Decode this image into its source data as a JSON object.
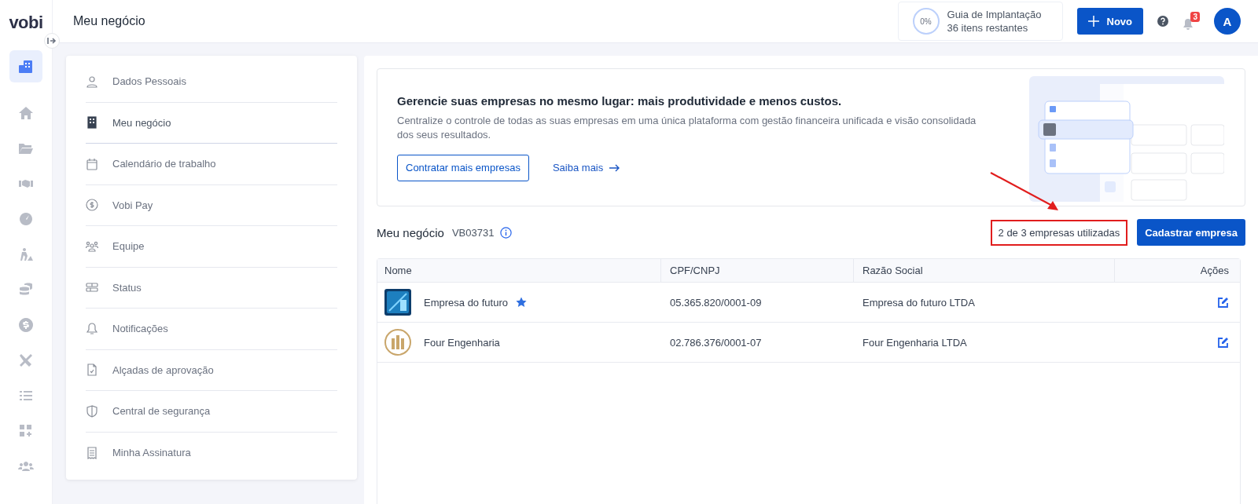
{
  "brand": "vobi",
  "rail": [
    {
      "selected": true
    },
    {
      "selected": false
    },
    {
      "selected": false
    },
    {
      "selected": false
    },
    {
      "selected": false
    },
    {
      "selected": false
    },
    {
      "selected": false
    },
    {
      "selected": false
    },
    {
      "selected": false
    },
    {
      "selected": false
    },
    {
      "selected": false
    },
    {
      "selected": false
    }
  ],
  "header": {
    "title": "Meu negócio",
    "guide": {
      "percent": "0%",
      "title": "Guia de Implantação",
      "subtitle": "36 itens restantes"
    },
    "new_button": "Novo",
    "notifications": "3",
    "avatar": "A"
  },
  "menu": [
    {
      "label": "Dados Pessoais",
      "selected": false
    },
    {
      "label": "Meu negócio",
      "selected": true
    },
    {
      "label": "Calendário de trabalho",
      "selected": false
    },
    {
      "label": "Vobi Pay",
      "selected": false
    },
    {
      "label": "Equipe",
      "selected": false
    },
    {
      "label": "Status",
      "selected": false
    },
    {
      "label": "Notificações",
      "selected": false
    },
    {
      "label": "Alçadas de aprovação",
      "selected": false
    },
    {
      "label": "Central de segurança",
      "selected": false
    },
    {
      "label": "Minha Assinatura",
      "selected": false
    }
  ],
  "banner": {
    "title": "Gerencie suas empresas no mesmo lugar: mais produtividade e menos custos.",
    "text": "Centralize o controle de todas as suas empresas em uma única plataforma com gestão financeira unificada e visão consolidada dos seus resultados.",
    "primary": "Contratar mais empresas",
    "link": "Saiba mais"
  },
  "section": {
    "title": "Meu negócio",
    "code": "VB03731",
    "usage": "2 de 3 empresas utilizadas",
    "usage_highlighted": true,
    "button": "Cadastrar empresa"
  },
  "table": {
    "columns": [
      "Nome",
      "CPF/CNPJ",
      "Razão Social",
      "Ações"
    ],
    "rows": [
      {
        "name": "Empresa do futuro",
        "favorite": true,
        "document": "05.365.820/0001-09",
        "legal_name": "Empresa do futuro LTDA"
      },
      {
        "name": "Four Engenharia",
        "favorite": false,
        "document": "02.786.376/0001-07",
        "legal_name": "Four Engenharia LTDA"
      }
    ]
  }
}
